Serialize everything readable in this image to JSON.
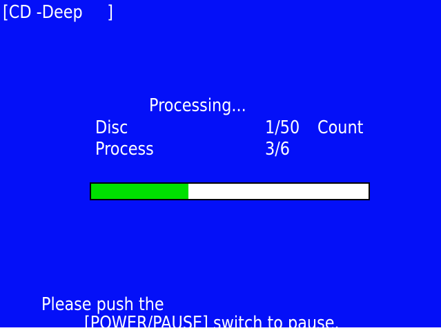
{
  "screen": {
    "title": "[CD -Deep     ]",
    "status": "Processing...",
    "disc": {
      "label": "Disc",
      "value": "1/50",
      "unit": "Count"
    },
    "process": {
      "label": "Process",
      "value": "3/6"
    },
    "progress": {
      "fraction": 0.35
    },
    "message": {
      "line1": "Please push the",
      "line2": "[POWER/PAUSE] switch to pause."
    }
  },
  "colors": {
    "background": "#0410f8",
    "text": "#ffffff",
    "progress_fill": "#00e000",
    "progress_track": "#ffffff"
  }
}
